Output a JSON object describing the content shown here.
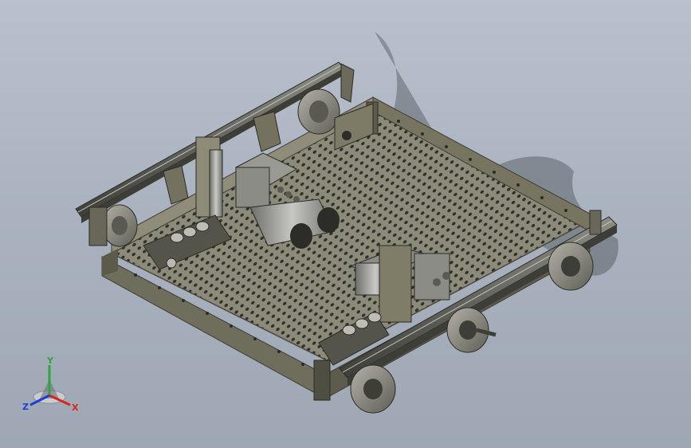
{
  "viewport": {
    "background_top": "#b9c1cd",
    "background_bottom": "#9ea7b3"
  },
  "model": {
    "frame_color": "#8a8775",
    "rail_color": "#55574f",
    "wheel_color": "#7c7a70",
    "motor_color": "#9b9c96",
    "hole_color": "#2d2e2a"
  },
  "triad": {
    "x_label": "X",
    "y_label": "Y",
    "z_label": "Z",
    "x_color": "#d8261f",
    "y_color": "#2ea63a",
    "z_color": "#1d3fd0"
  }
}
